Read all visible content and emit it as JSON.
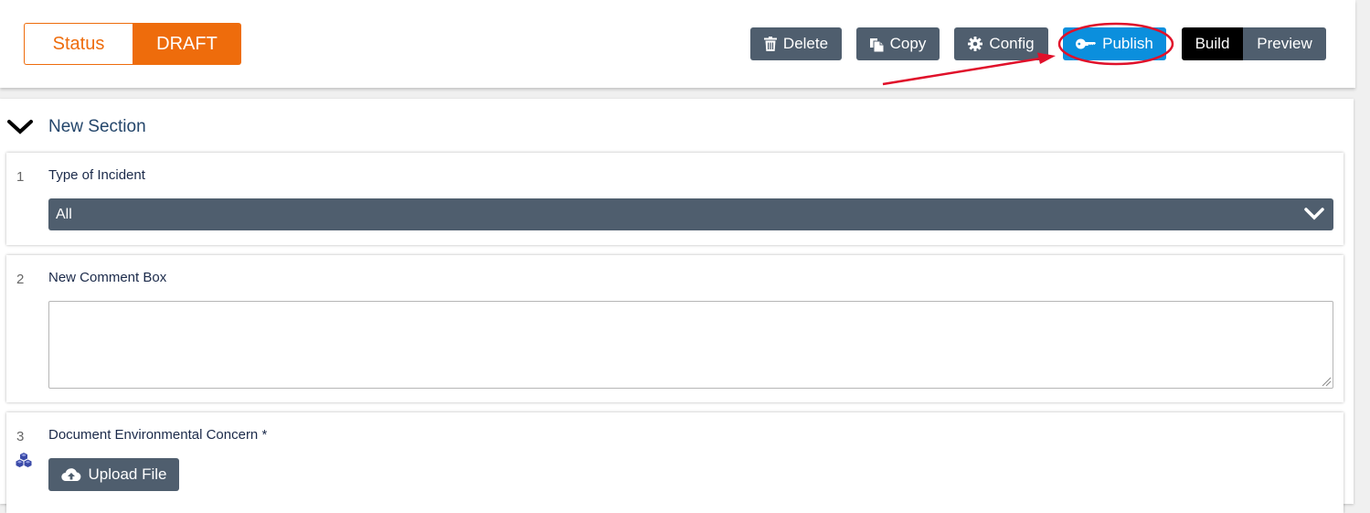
{
  "toolbar": {
    "status_label": "Status",
    "status_value": "DRAFT",
    "delete_label": "Delete",
    "copy_label": "Copy",
    "config_label": "Config",
    "publish_label": "Publish",
    "build_label": "Build",
    "preview_label": "Preview",
    "active_mode": "Build"
  },
  "icons": {
    "delete": "trash-icon",
    "copy": "copy-icon",
    "config": "gear-icon",
    "publish": "key-icon",
    "section_toggle": "chevron-down-icon",
    "select_arrow": "chevron-down-icon",
    "upload": "cloud-upload-icon",
    "field_type": "cubes-icon"
  },
  "colors": {
    "status_accent": "#ee6c0c",
    "button_bg": "#4f5e6e",
    "publish_bg": "#0b8fdd",
    "build_active_bg": "#000000",
    "annotation": "#e0102a",
    "section_title": "#24466b"
  },
  "section": {
    "title": "New Section",
    "questions": [
      {
        "number": "1",
        "label": "Type of Incident",
        "type": "select",
        "value": "All"
      },
      {
        "number": "2",
        "label": "New Comment Box",
        "type": "textarea",
        "value": ""
      },
      {
        "number": "3",
        "label": "Document Environmental Concern *",
        "type": "file",
        "button_label": "Upload File"
      }
    ]
  }
}
